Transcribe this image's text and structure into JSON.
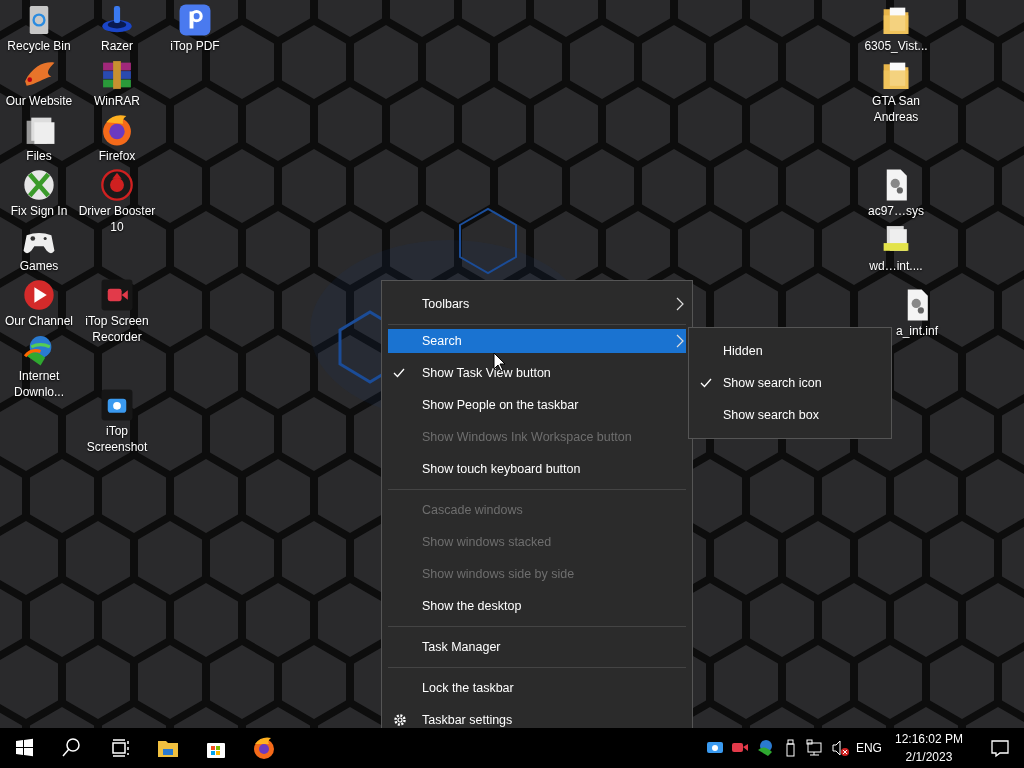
{
  "desktop_icons": [
    {
      "label": "Recycle Bin",
      "kind": "recycle"
    },
    {
      "label": "Our Website",
      "kind": "bird"
    },
    {
      "label": "Files",
      "kind": "pages"
    },
    {
      "label": "Fix Sign In",
      "kind": "xball"
    },
    {
      "label": "Games",
      "kind": "gamepad"
    },
    {
      "label": "Our Channel",
      "kind": "play"
    },
    {
      "label": "Internet Downlo...",
      "kind": "globe"
    },
    {
      "label": "Razer",
      "kind": "ring"
    },
    {
      "label": "WinRAR",
      "kind": "books"
    },
    {
      "label": "Firefox",
      "kind": "fox"
    },
    {
      "label": "Driver Booster 10",
      "kind": "booster"
    },
    {
      "label": "iTop Screen Recorder",
      "kind": "recorder"
    },
    {
      "label": "iTop Screenshot",
      "kind": "snap"
    },
    {
      "label": "iTop PDF",
      "kind": "pdf"
    },
    {
      "label": "6305_Vist...",
      "kind": "folder"
    },
    {
      "label": "GTA San Andreas",
      "kind": "folder"
    },
    {
      "label": "ac97…sys",
      "kind": "gearfile"
    },
    {
      "label": "wd…int....",
      "kind": "stackfile"
    },
    {
      "label": "a_int.inf",
      "kind": "gearfile"
    }
  ],
  "context_menu": {
    "items": [
      {
        "kind": "submenu",
        "label": "Toolbars",
        "checked": false,
        "disabled": false,
        "selected": false
      },
      {
        "kind": "separator"
      },
      {
        "kind": "submenu",
        "label": "Search",
        "checked": false,
        "disabled": false,
        "selected": true
      },
      {
        "kind": "item",
        "label": "Show Task View button",
        "checked": true,
        "disabled": false,
        "selected": false
      },
      {
        "kind": "item",
        "label": "Show People on the taskbar",
        "checked": false,
        "disabled": false,
        "selected": false
      },
      {
        "kind": "item",
        "label": "Show Windows Ink Workspace button",
        "checked": false,
        "disabled": true,
        "selected": false
      },
      {
        "kind": "item",
        "label": "Show touch keyboard button",
        "checked": false,
        "disabled": false,
        "selected": false
      },
      {
        "kind": "separator"
      },
      {
        "kind": "item",
        "label": "Cascade windows",
        "checked": false,
        "disabled": true,
        "selected": false
      },
      {
        "kind": "item",
        "label": "Show windows stacked",
        "checked": false,
        "disabled": true,
        "selected": false
      },
      {
        "kind": "item",
        "label": "Show windows side by side",
        "checked": false,
        "disabled": true,
        "selected": false
      },
      {
        "kind": "item",
        "label": "Show the desktop",
        "checked": false,
        "disabled": false,
        "selected": false
      },
      {
        "kind": "separator"
      },
      {
        "kind": "item",
        "label": "Task Manager",
        "checked": false,
        "disabled": false,
        "selected": false
      },
      {
        "kind": "separator"
      },
      {
        "kind": "item",
        "label": "Lock the taskbar",
        "checked": false,
        "disabled": false,
        "selected": false
      },
      {
        "kind": "settings",
        "label": "Taskbar settings",
        "checked": false,
        "disabled": false,
        "selected": false
      }
    ]
  },
  "submenu": {
    "items": [
      {
        "label": "Hidden",
        "checked": false
      },
      {
        "label": "Show search icon",
        "checked": true
      },
      {
        "label": "Show search box",
        "checked": false
      }
    ]
  },
  "taskbar": {
    "language": "ENG",
    "time": "12:16:02 PM",
    "date": "2/1/2023"
  }
}
